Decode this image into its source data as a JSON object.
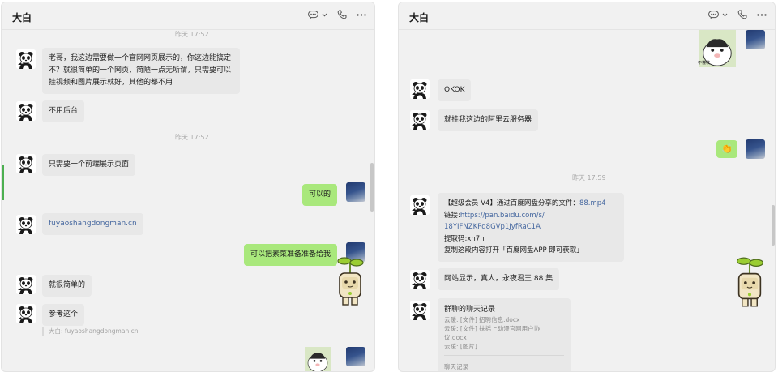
{
  "left_window": {
    "title": "大白",
    "timestamps": [
      "昨天 17:52",
      "昨天 17:52"
    ],
    "messages": [
      {
        "text": "老哥，我这边需要做一个官网网页展示的，你这边能搞定不？就很简单的一个网页，简陋一点无所谓，只需要可以挂视频和图片展示就好，其他的都不用"
      },
      {
        "text": "不用后台"
      },
      {
        "text": "只需要一个前端展示页面"
      },
      {
        "text": "可以的"
      },
      {
        "text": "fuyaoshangdongman.cn"
      },
      {
        "text": "可以把素菜准备准备给我"
      },
      {
        "text": "就很简单的"
      },
      {
        "text": "参考这个"
      }
    ],
    "quote": "大白: fuyaoshangdongman.cn"
  },
  "right_window": {
    "title": "大白",
    "sticker_caption": "不懂哎",
    "timestamp": "昨天 17:59",
    "messages": [
      {
        "text": "OKOK"
      },
      {
        "text": "就挂我这边的阿里云服务器"
      },
      {
        "text": "👏"
      }
    ],
    "share": {
      "line1_prefix": "【超级会员 V4】通过百度网盘分享的文件：",
      "line1_file": "88.mp4",
      "line2_label": "链接:",
      "line2_url_a": "https://pan.baidu.com/s/",
      "line2_url_b": "18YIFNZKPq8GVp1JyfRaC1A",
      "line3": "提取码:xh7n",
      "line4": "复制这段内容打开「百度网盘APP 即可获取」"
    },
    "message_after": "网站显示，真人，永夜君王 88 集",
    "record": {
      "title": "群聊的聊天记录",
      "lines": [
        "云暖: [文件] 招聘信息.docx",
        "云暖: [文件] 扶摇上动漫官网用户协",
        "议.docx",
        "云暖: [图片]..."
      ],
      "footer": "聊天记录"
    }
  },
  "icons": [
    "chat-bubble-icon",
    "chevron-down-icon",
    "phone-icon",
    "more-icon"
  ],
  "colors": {
    "bubble_self": "#a9e87c",
    "bubble_other": "#e8e8e8",
    "link": "#45679f",
    "window_bg": "#f1f1f1"
  }
}
